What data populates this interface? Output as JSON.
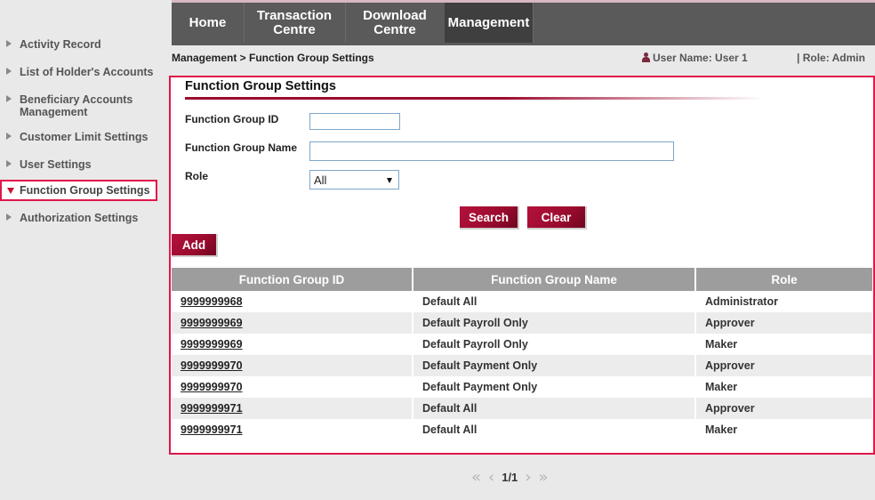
{
  "sidebar": {
    "items": [
      {
        "label": "Activity Record"
      },
      {
        "label": "List of Holder's Accounts"
      },
      {
        "label": "Beneficiary Accounts Management"
      },
      {
        "label": "Customer Limit Settings"
      },
      {
        "label": "User Settings"
      },
      {
        "label": "Function Group Settings",
        "active": true
      },
      {
        "label": "Authorization Settings"
      }
    ]
  },
  "nav": {
    "items": [
      {
        "label": "Home"
      },
      {
        "label": "Transaction Centre"
      },
      {
        "label": "Download Centre"
      },
      {
        "label": "Management",
        "active": true
      }
    ]
  },
  "breadcrumb": "Management > Function Group Settings",
  "user": {
    "name": "User Name: User 1",
    "role": "| Role: Admin"
  },
  "panel": {
    "title": "Function Group Settings",
    "form": {
      "id_label": "Function Group ID",
      "id_value": "",
      "name_label": "Function Group Name",
      "name_value": "",
      "role_label": "Role",
      "role_selected": "All"
    },
    "buttons": {
      "search": "Search",
      "clear": "Clear",
      "add": "Add"
    }
  },
  "table": {
    "headers": [
      "Function Group ID",
      "Function Group Name",
      "Role"
    ],
    "rows": [
      [
        "9999999968",
        "Default All",
        "Administrator"
      ],
      [
        "9999999969",
        "Default Payroll Only",
        "Approver"
      ],
      [
        "9999999969",
        "Default Payroll Only",
        "Maker"
      ],
      [
        "9999999970",
        "Default Payment Only",
        "Approver"
      ],
      [
        "9999999970",
        "Default Payment Only",
        "Maker"
      ],
      [
        "9999999971",
        "Default All",
        "Approver"
      ],
      [
        "9999999971",
        "Default All",
        "Maker"
      ]
    ]
  },
  "pagination": {
    "page": "1/1"
  },
  "colors": {
    "accent": "#e0174b",
    "button": "#9a0a2e",
    "nav_bg": "#5a5a5a",
    "header_bg": "#9d9d9d"
  }
}
